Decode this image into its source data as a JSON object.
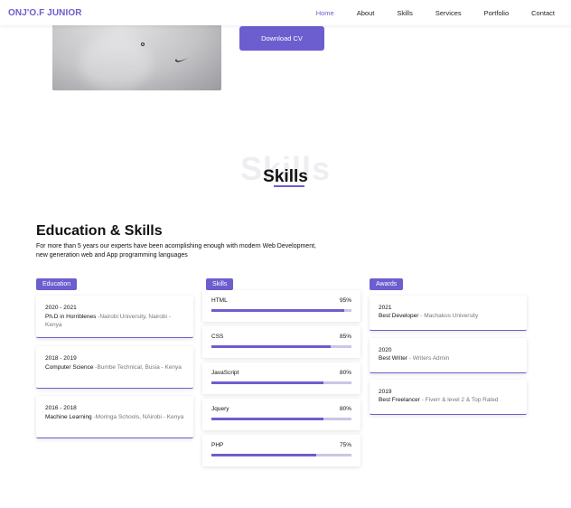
{
  "nav": {
    "logo": "ONJ'O.F JUNIOR",
    "links": [
      "Home",
      "About",
      "Skills",
      "Services",
      "Portfolio",
      "Contact"
    ]
  },
  "hero": {
    "download_label": "Download CV"
  },
  "skills_section": {
    "bg_title": "Skills",
    "title": "Skills",
    "heading": "Education & Skills",
    "description": "For more than 5 years our experts have been acomplishing enough with modern Web Development, new generation web and App programming languages"
  },
  "education": {
    "badge": "Education",
    "items": [
      {
        "years": "2020 - 2021",
        "title": "Ph.D in Horriblenes",
        "place": " -Nairobi University, Nairobi - Kenya"
      },
      {
        "years": "2018 - 2019",
        "title": "Computer Science",
        "place": " -Bumbe Technical, Busia - Kenya"
      },
      {
        "years": "2016 - 2018",
        "title": "Machine Learning",
        "place": " -Moringa Schools, NAirobi - Kenya"
      }
    ]
  },
  "skills": {
    "badge": "Skills",
    "items": [
      {
        "name": "HTML",
        "percent_label": "95%",
        "level": 0.95
      },
      {
        "name": "CSS",
        "percent_label": "85%",
        "level": 0.85
      },
      {
        "name": "JavaScript",
        "percent_label": "80%",
        "level": 0.8
      },
      {
        "name": "Jquery",
        "percent_label": "80%",
        "level": 0.8
      },
      {
        "name": "PHP",
        "percent_label": "75%",
        "level": 0.75
      }
    ]
  },
  "awards": {
    "badge": "Awards",
    "items": [
      {
        "year": "2021",
        "title": "Best Developer",
        "org": " - Machakos University"
      },
      {
        "year": "2020",
        "title": "Best Writer",
        "org": " - Writers Admin"
      },
      {
        "year": "2019",
        "title": "Best Freelancer",
        "org": " - Fiverr & level 2 & Top Rated"
      }
    ]
  },
  "colors": {
    "accent": "#6c5ecf",
    "track": "#c9c6e6"
  },
  "icons": [
    "nike-swoosh-icon"
  ]
}
